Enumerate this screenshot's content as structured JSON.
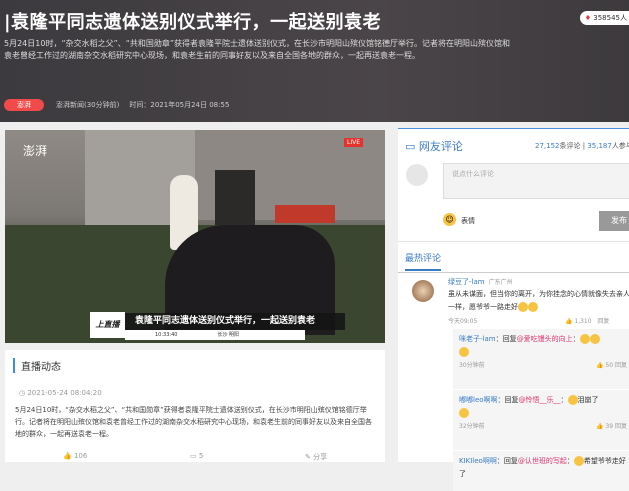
{
  "header": {
    "title": "|袁隆平同志遗体送别仪式举行，一起送别袁老",
    "heat": "358545人",
    "description": "5月24日10时，“杂交水稻之父”、“共和国勋章”获得者袁隆平院士遗体送别仪式，在长沙市明阳山殡仪馆铭德厅举行。记者将在明阳山殡仪馆和袁老曾经工作过的湖南杂交水稻研究中心现场，和袁老生前的同事好友以及来自全国各地的群众，一起再送袁老一程。",
    "tag": "澎湃",
    "source": "澎湃新闻(30分钟前)",
    "time": "时间：2021年05月24日 08:55"
  },
  "video": {
    "logo": "澎湃",
    "live_badge": "LIVE",
    "caption": "袁隆平同志遗体送别仪式举行，一起送别袁老",
    "caption_badge": "上直播",
    "caption_time": "10:33:40",
    "caption_loc": "长沙 明阳"
  },
  "feed": {
    "title": "直播动态",
    "time": "2021-05-24 08:04:20",
    "text_prefix": "5月24日10时，“杂交水稻之父”、“共和国勋章”获得者袁隆平院士遗体送别仪式，在长沙市明阳山殡仪馆铭德厅举行。记者将在明阳山殡仪馆和袁老曾经工作过的湖南杂交水稻研究中心现场，和袁老生前的同事好友以及来自全国各地的群众，一起再送袁老一程。",
    "likes": "106",
    "comments": "5",
    "share": "分享"
  },
  "comments": {
    "title": "网友评论",
    "count": "27,152",
    "count_label": "条评论",
    "people": "35,187",
    "people_label": "人参与",
    "placeholder": "说点什么评论",
    "emoji_label": "表情",
    "send": "发布",
    "hot_tab": "最热评论",
    "top": {
      "user": "绿豆了-lam",
      "loc": "广东广州",
      "text": "虽从未谋面，但当你的离开，为你挂念的心情就像失去亲人一样，愿爷爷一路走好",
      "time": "今天09:05",
      "likes": "1,310",
      "reply": "回复"
    },
    "replies": [
      {
        "user": "咪老子-lam",
        "text": "回复",
        "at": "@爱吃馒头的向上",
        "time": "30分钟前",
        "likes": "50",
        "reply": "回复"
      },
      {
        "user": "嘟嘟leo啊啊",
        "text": "回复",
        "at": "@怜悟__乐__",
        "tail": "泪崩了",
        "time": "32分钟前",
        "likes": "39",
        "reply": "回复"
      },
      {
        "user": "KIKIleo啊啊",
        "text": "回复",
        "at": "@认世班的写起",
        "tail": "希望爷爷走好了",
        "time": "",
        "likes": "",
        "reply": ""
      }
    ]
  }
}
